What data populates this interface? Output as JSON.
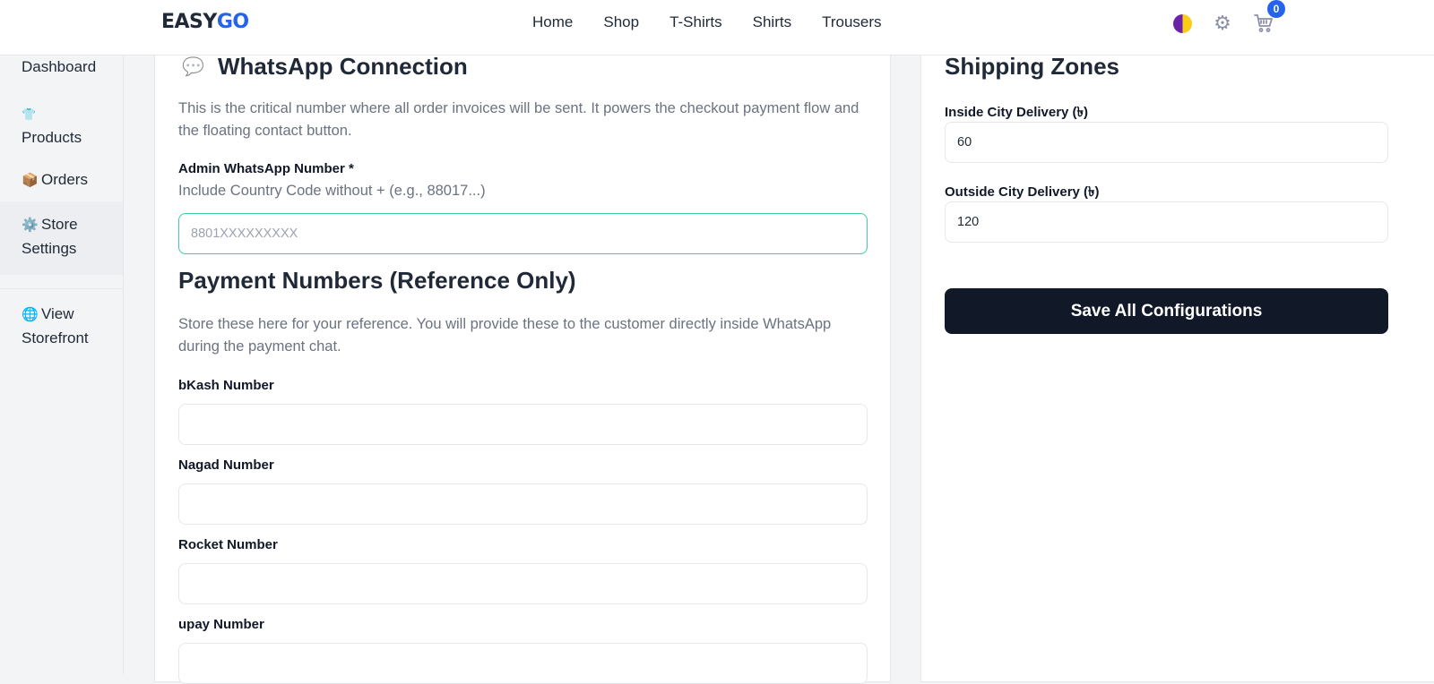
{
  "brand": {
    "part1": "EASY",
    "part2": "GO"
  },
  "nav": [
    "Home",
    "Shop",
    "T-Shirts",
    "Shirts",
    "Trousers"
  ],
  "header_icons": {
    "theme": "theme-toggle-icon",
    "settings": "gear-icon",
    "cart": "cart-icon",
    "cart_count": "0"
  },
  "sidebar": {
    "items": [
      {
        "icon": "",
        "label": "Dashboard"
      },
      {
        "icon": "👕",
        "label": "Products"
      },
      {
        "icon": "📦",
        "label": "Orders"
      },
      {
        "icon": "⚙️",
        "label": "Store Settings"
      },
      {
        "icon": "🌐",
        "label": "View Storefront"
      }
    ]
  },
  "whatsapp": {
    "icon": "💬",
    "title": "WhatsApp Connection",
    "description": "This is the critical number where all order invoices will be sent. It powers the checkout payment flow and the floating contact button.",
    "field_label": "Admin WhatsApp Number *",
    "field_hint": "Include Country Code without + (e.g., 88017...)",
    "placeholder": "8801XXXXXXXXX",
    "value": ""
  },
  "payment": {
    "title": "Payment Numbers (Reference Only)",
    "description": "Store these here for your reference. You will provide these to the customer directly inside WhatsApp during the payment chat.",
    "fields": [
      {
        "label": "bKash Number",
        "value": ""
      },
      {
        "label": "Nagad Number",
        "value": ""
      },
      {
        "label": "Rocket Number",
        "value": ""
      },
      {
        "label": "upay Number",
        "value": ""
      }
    ]
  },
  "shipping": {
    "title": "Shipping Zones",
    "inside_label": "Inside City Delivery (৳)",
    "inside_value": "60",
    "outside_label": "Outside City Delivery (৳)",
    "outside_value": "120"
  },
  "save_label": "Save All Configurations",
  "colors": {
    "accent": "#2563eb",
    "primary_button": "#111827",
    "focus_border": "#34d399"
  }
}
